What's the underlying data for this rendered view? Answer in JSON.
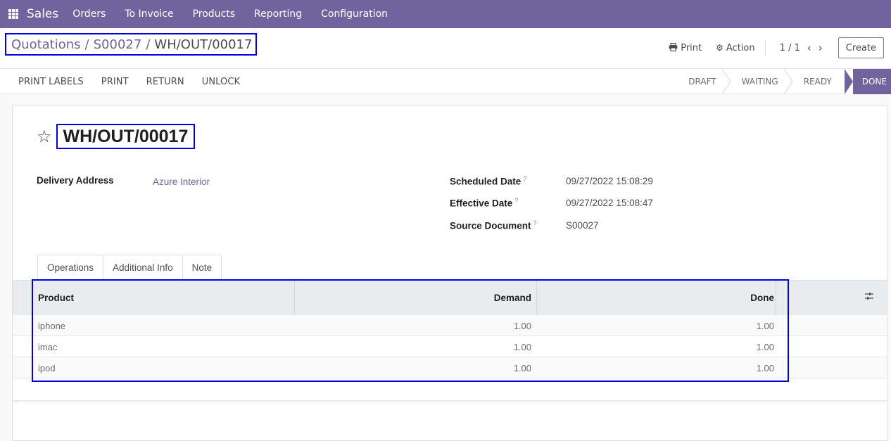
{
  "navbar": {
    "brand": "Sales",
    "menu": [
      "Orders",
      "To Invoice",
      "Products",
      "Reporting",
      "Configuration"
    ]
  },
  "breadcrumb": {
    "items": [
      "Quotations",
      "S00027"
    ],
    "current": "WH/OUT/00017",
    "separator": "/"
  },
  "control": {
    "print_label": "Print",
    "action_label": "Action",
    "pager": "1 / 1",
    "create_label": "Create"
  },
  "actions": [
    "PRINT LABELS",
    "PRINT",
    "RETURN",
    "UNLOCK"
  ],
  "stages": {
    "list": [
      "DRAFT",
      "WAITING",
      "READY",
      "DONE"
    ],
    "current": "DONE"
  },
  "record": {
    "title": "WH/OUT/00017",
    "delivery_address_label": "Delivery Address",
    "delivery_address": "Azure Interior",
    "scheduled_date_label": "Scheduled Date",
    "scheduled_date": "09/27/2022 15:08:29",
    "effective_date_label": "Effective Date",
    "effective_date": "09/27/2022 15:08:47",
    "source_document_label": "Source Document",
    "source_document": "S00027",
    "help_mark": "?"
  },
  "tabs": [
    "Operations",
    "Additional Info",
    "Note"
  ],
  "table": {
    "columns": [
      "Product",
      "Demand",
      "Done"
    ],
    "rows": [
      {
        "product": "iphone",
        "demand": "1.00",
        "done": "1.00"
      },
      {
        "product": "imac",
        "demand": "1.00",
        "done": "1.00"
      },
      {
        "product": "ipod",
        "demand": "1.00",
        "done": "1.00"
      }
    ]
  },
  "colors": {
    "brand": "#71639e",
    "highlight": "#0000dd"
  }
}
